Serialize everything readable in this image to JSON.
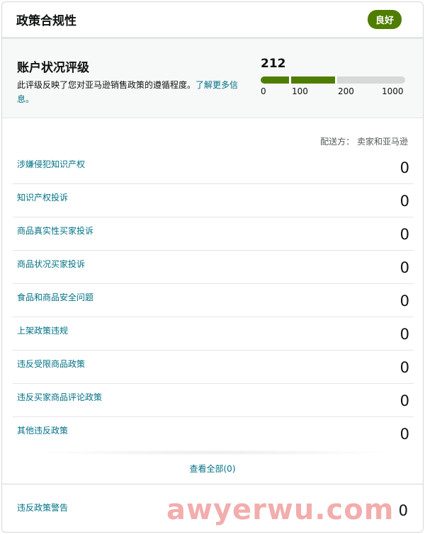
{
  "header": {
    "title": "政策合规性",
    "status_badge": "良好"
  },
  "rating": {
    "title": "账户状况评级",
    "description": "此评级反映了您对亚马逊销售政策的遵循程度。",
    "learn_more": "了解更多信息。",
    "score": "212",
    "ticks": [
      "0",
      "100",
      "200",
      "1000"
    ]
  },
  "fulfillment": {
    "label": "配送方：  卖家和亚马逊"
  },
  "violations": [
    {
      "label": "涉嫌侵犯知识产权",
      "count": "0"
    },
    {
      "label": "知识产权投诉",
      "count": "0"
    },
    {
      "label": "商品真实性买家投诉",
      "count": "0"
    },
    {
      "label": "商品状况买家投诉",
      "count": "0"
    },
    {
      "label": "食品和商品安全问题",
      "count": "0"
    },
    {
      "label": "上架政策违规",
      "count": "0"
    },
    {
      "label": "违反受限商品政策",
      "count": "0"
    },
    {
      "label": "违反买家商品评论政策",
      "count": "0"
    },
    {
      "label": "其他违反政策",
      "count": "0"
    }
  ],
  "view_all": "查看全部(0)",
  "warnings": {
    "label": "违反政策警告",
    "count": "0"
  },
  "watermark": "awyerwu.com",
  "colors": {
    "accent": "#4f7d00",
    "link": "#007185",
    "bar_bg": "#d5d9d9"
  }
}
